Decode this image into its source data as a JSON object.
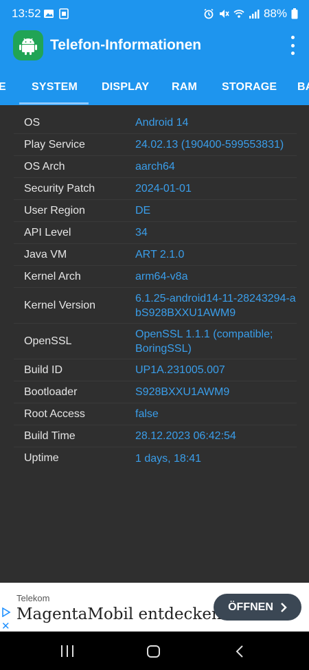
{
  "status_bar": {
    "time": "13:52",
    "battery": "88%",
    "icons": [
      "gallery-icon",
      "sim-icon",
      "alarm-icon",
      "mute-icon",
      "wifi-icon",
      "signal-icon",
      "battery-icon"
    ]
  },
  "app": {
    "title": "Telefon-Informationen",
    "logo_icon": "android-icon",
    "accent_color": "#1e95ee"
  },
  "tabs": [
    {
      "label": "E"
    },
    {
      "label": "SYSTEM",
      "active": true
    },
    {
      "label": "DISPLAY"
    },
    {
      "label": "RAM"
    },
    {
      "label": "STORAGE"
    },
    {
      "label": "BA"
    }
  ],
  "system_info": [
    {
      "key": "OS",
      "value": "Android 14"
    },
    {
      "key": "Play Service",
      "value": "24.02.13 (190400-599553831)"
    },
    {
      "key": "OS Arch",
      "value": "aarch64"
    },
    {
      "key": "Security Patch",
      "value": "2024-01-01"
    },
    {
      "key": "User Region",
      "value": "DE"
    },
    {
      "key": "API Level",
      "value": "34"
    },
    {
      "key": "Java VM",
      "value": "ART 2.1.0"
    },
    {
      "key": "Kernel Arch",
      "value": "arm64-v8a"
    },
    {
      "key": "Kernel Version",
      "value": "6.1.25-android14-11-28243294-abS928BXXU1AWM9"
    },
    {
      "key": "OpenSSL",
      "value": "OpenSSL 1.1.1 (compatible; BoringSSL)"
    },
    {
      "key": "Build ID",
      "value": "UP1A.231005.007"
    },
    {
      "key": "Bootloader",
      "value": "S928BXXU1AWM9"
    },
    {
      "key": "Root Access",
      "value": "false"
    },
    {
      "key": "Build Time",
      "value": "28.12.2023 06:42:54"
    },
    {
      "key": "Uptime",
      "value": "1 days, 18:41"
    }
  ],
  "ad": {
    "brand": "Telekom",
    "headline": "MagentaMobil entdecken",
    "cta": "ÖFFNEN",
    "close": "✕"
  },
  "nav_bar": {
    "icons": [
      "recents-icon",
      "home-icon",
      "back-icon"
    ]
  }
}
